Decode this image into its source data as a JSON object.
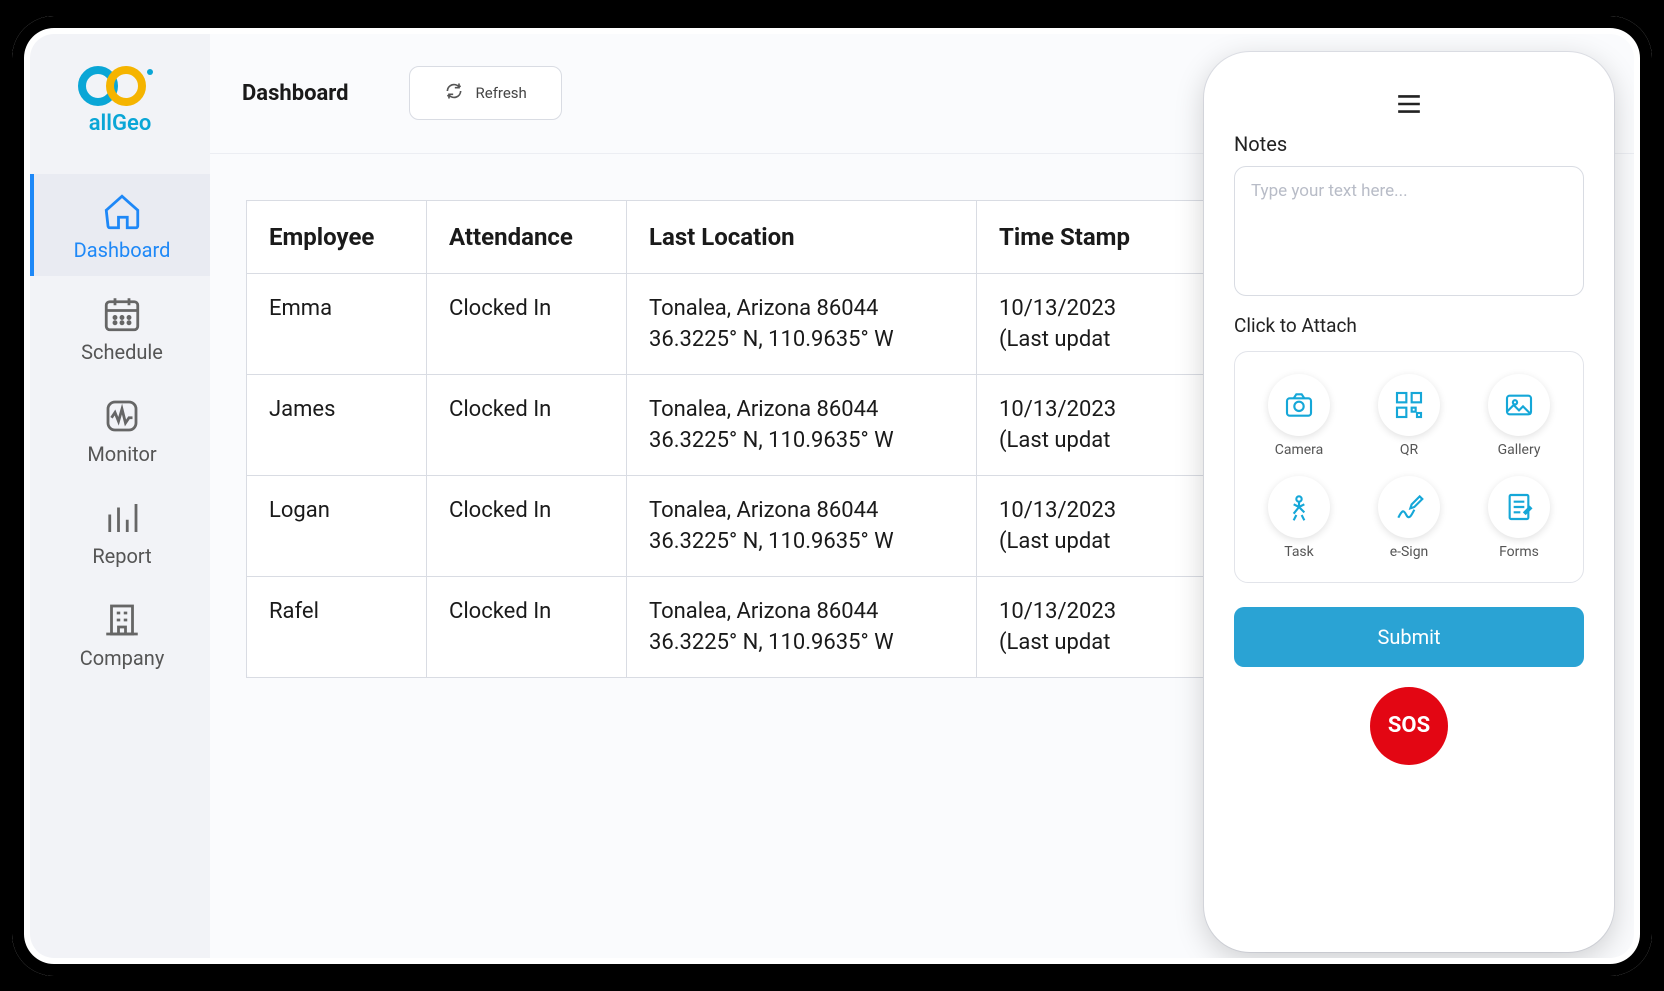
{
  "brand": {
    "name": "allGeo"
  },
  "sidebar": {
    "items": [
      {
        "label": "Dashboard",
        "icon": "home"
      },
      {
        "label": "Schedule",
        "icon": "calendar"
      },
      {
        "label": "Monitor",
        "icon": "monitor"
      },
      {
        "label": "Report",
        "icon": "report"
      },
      {
        "label": "Company",
        "icon": "company"
      }
    ]
  },
  "header": {
    "title": "Dashboard",
    "refresh_label": "Refresh"
  },
  "table": {
    "columns": [
      "Employee",
      "Attendance",
      "Last Location",
      "Time Stamp"
    ],
    "rows": [
      {
        "employee": "Emma",
        "attendance": "Clocked In",
        "location_line1": "Tonalea, Arizona 86044",
        "location_line2": "36.3225° N, 110.9635° W",
        "timestamp_line1": "10/13/2023",
        "timestamp_line2": "(Last updat"
      },
      {
        "employee": "James",
        "attendance": "Clocked In",
        "location_line1": "Tonalea, Arizona 86044",
        "location_line2": "36.3225° N, 110.9635° W",
        "timestamp_line1": "10/13/2023",
        "timestamp_line2": "(Last updat"
      },
      {
        "employee": "Logan",
        "attendance": "Clocked In",
        "location_line1": "Tonalea, Arizona 86044",
        "location_line2": "36.3225° N, 110.9635° W",
        "timestamp_line1": "10/13/2023",
        "timestamp_line2": "(Last updat"
      },
      {
        "employee": "Rafel",
        "attendance": "Clocked In",
        "location_line1": "Tonalea, Arizona 86044",
        "location_line2": "36.3225° N, 110.9635° W",
        "timestamp_line1": "10/13/2023",
        "timestamp_line2": "(Last updat"
      }
    ]
  },
  "phone": {
    "notes_heading": "Notes",
    "notes_placeholder": "Type your text here...",
    "attach_heading": "Click to Attach",
    "attach_items": [
      {
        "label": "Camera",
        "icon": "camera"
      },
      {
        "label": "QR",
        "icon": "qr"
      },
      {
        "label": "Gallery",
        "icon": "gallery"
      },
      {
        "label": "Task",
        "icon": "task"
      },
      {
        "label": "e-Sign",
        "icon": "esign"
      },
      {
        "label": "Forms",
        "icon": "forms"
      }
    ],
    "submit_label": "Submit",
    "sos_label": "SOS"
  }
}
